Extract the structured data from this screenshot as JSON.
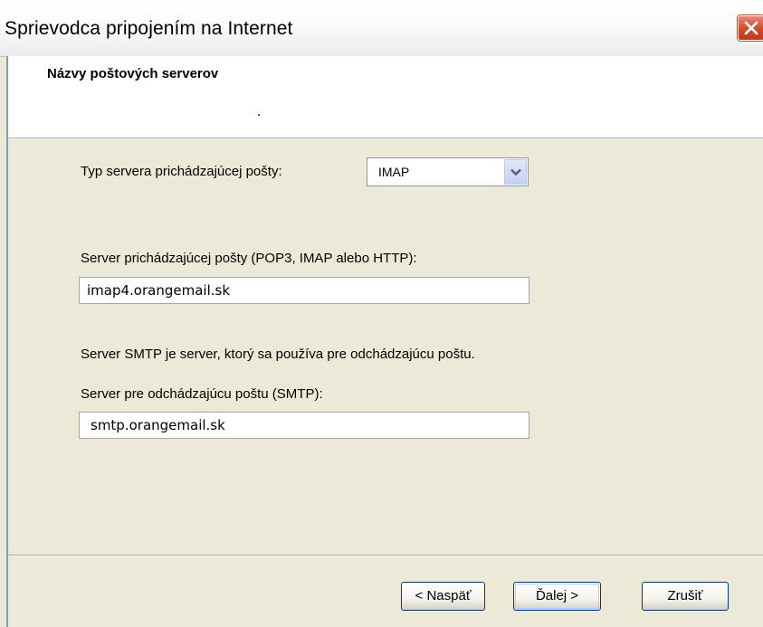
{
  "window": {
    "title": "Sprievodca pripojením na Internet",
    "close_icon": "close-icon"
  },
  "header": {
    "title": "Názvy poštových serverov"
  },
  "form": {
    "server_type_label": "Typ servera prichádzajúcej pošty:",
    "server_type_value": "IMAP",
    "incoming_label": "Server prichádzajúcej pošty (POP3, IMAP alebo HTTP):",
    "incoming_value": "imap4.orangemail.sk",
    "smtp_info": "Server SMTP je server, ktorý sa používa pre odchádzajúcu poštu.",
    "outgoing_label": "Server pre odchádzajúcu poštu (SMTP):",
    "outgoing_value": "smtp.orangemail.sk"
  },
  "buttons": {
    "back": "< Naspäť",
    "next": "Ďalej >",
    "cancel": "Zrušiť"
  },
  "colors": {
    "dialog_bg": "#ece9d8",
    "close_button": "#d1492c",
    "button_border": "#003c74"
  }
}
